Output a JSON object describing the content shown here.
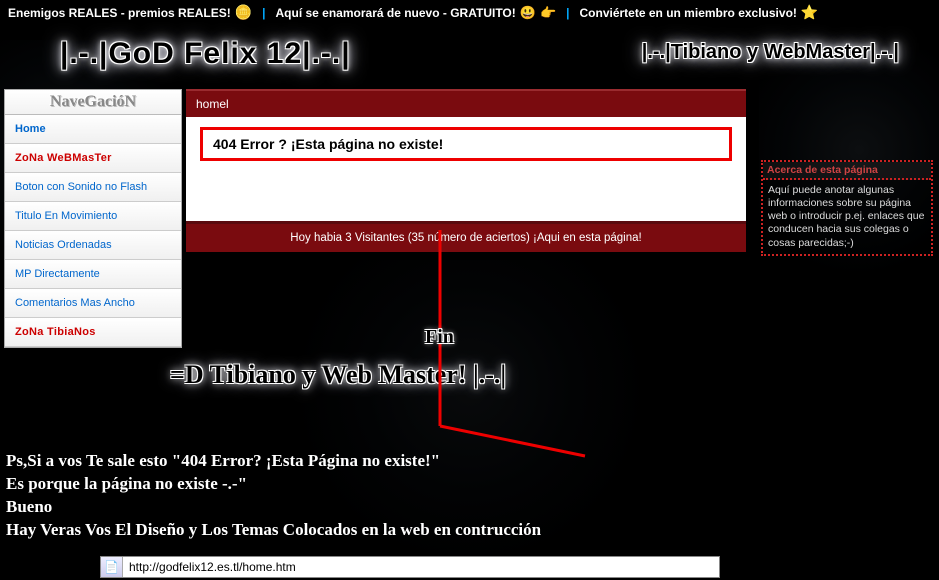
{
  "topbar": {
    "link1": "Enemigos REALES - premios REALES!",
    "link2": "Aquí se enamorará de nuevo - GRATUITO!",
    "link3": "Conviértete en un miembro exclusivo!"
  },
  "banner": {
    "title_left": "|.-.|GoD Felix 12|.-.|",
    "title_right": "|.-.|Tibiano y WebMaster|.-.|"
  },
  "sidebar": {
    "heading": "NaveGacióN",
    "items": [
      {
        "label": "Home",
        "style": "home"
      },
      {
        "label": "ZoNa WeBMasTer",
        "style": "red"
      },
      {
        "label": "Boton con Sonido no Flash",
        "style": ""
      },
      {
        "label": "Titulo En Movimiento",
        "style": ""
      },
      {
        "label": "Noticias Ordenadas",
        "style": ""
      },
      {
        "label": "MP Directamente",
        "style": ""
      },
      {
        "label": "Comentarios Mas Ancho",
        "style": ""
      },
      {
        "label": "ZoNa TibiaNos",
        "style": "red"
      }
    ]
  },
  "content": {
    "breadcrumb": "homel",
    "error_text": "404 Error ? ¡Esta página no existe!",
    "footer_text": "Hoy habia 3 Visitantes (35 número de aciertos) ¡Aqui en esta página!"
  },
  "aside": {
    "heading": "Acerca de esta página",
    "body": "Aquí puede anotar algunas informaciones sobre su página web o introducir p.ej. enlaces que conducen hacia sus colegas o cosas parecidas;-)"
  },
  "fin_label": "Fin",
  "big_line": "=D Tibiano y Web Master! |.-.|",
  "bottom_text": {
    "l1": "Ps,Si a vos Te sale esto  \"404 Error? ¡Esta Página no existe!\"",
    "l2": "Es porque la página no existe -.-\"",
    "l3": "Bueno",
    "l4": "Hay Veras Vos El Diseño y Los Temas Colocados en la web en contrucción"
  },
  "address_bar": {
    "url": "http://godfelix12.es.tl/home.htm"
  }
}
